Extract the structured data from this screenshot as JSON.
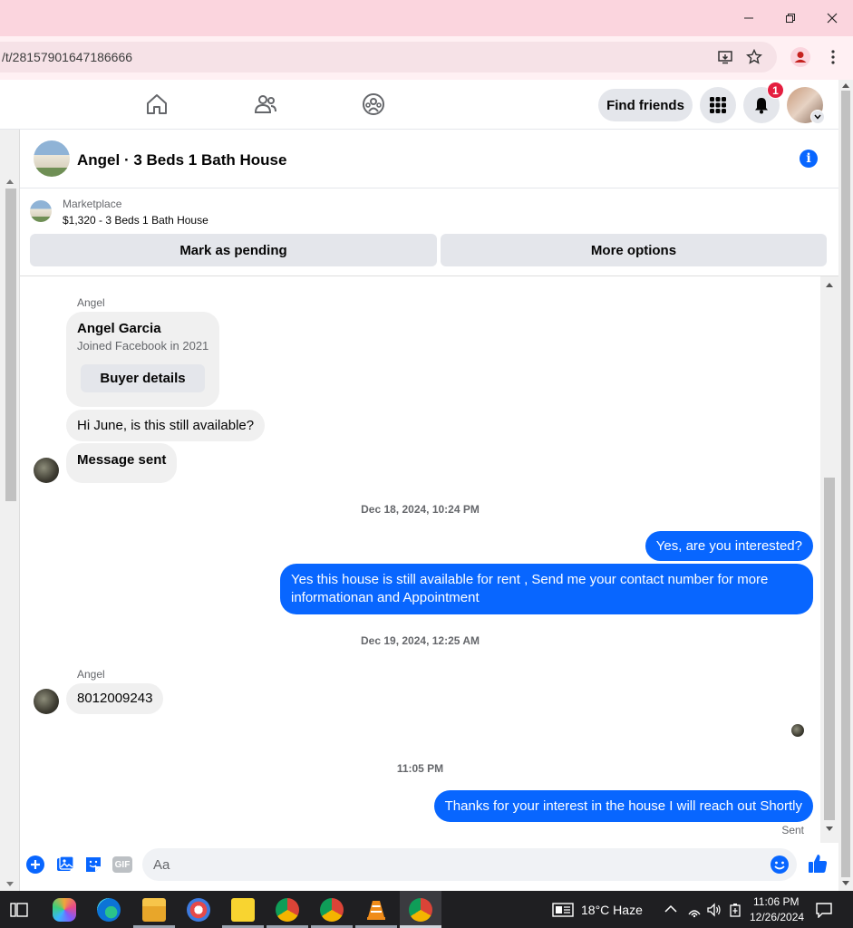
{
  "browser": {
    "url": "/t/28157901647186666"
  },
  "nav": {
    "find_friends": "Find friends",
    "notif_count": "1"
  },
  "chat": {
    "title": "Angel · 3 Beds 1 Bath House"
  },
  "marketplace": {
    "label": "Marketplace",
    "listing": "$1,320 - 3 Beds 1 Bath House",
    "mark_pending": "Mark as pending",
    "more_options": "More options"
  },
  "messages": {
    "sender1": "Angel",
    "buyer_name": "Angel Garcia",
    "buyer_joined": "Joined Facebook in 2021",
    "buyer_details": "Buyer details",
    "msg1": "Hi June, is this still available?",
    "msg2": "Message sent",
    "ts1": "Dec 18, 2024, 10:24 PM",
    "out1": "Yes, are you interested?",
    "out2": "Yes this house is still available for rent , Send me your contact number for more informationan and Appointment",
    "ts2": "Dec 19, 2024, 12:25 AM",
    "sender2": "Angel",
    "msg3": "8012009243",
    "ts3": "11:05 PM",
    "out3": "Thanks for your interest in the house I will reach out Shortly",
    "sent": "Sent"
  },
  "composer": {
    "placeholder": "Aa",
    "gif": "GIF"
  },
  "taskbar": {
    "weather": "18°C  Haze",
    "time": "11:06 PM",
    "date": "12/26/2024"
  },
  "colors": {
    "accent": "#0866ff",
    "titlebar": "#fbd5de"
  }
}
